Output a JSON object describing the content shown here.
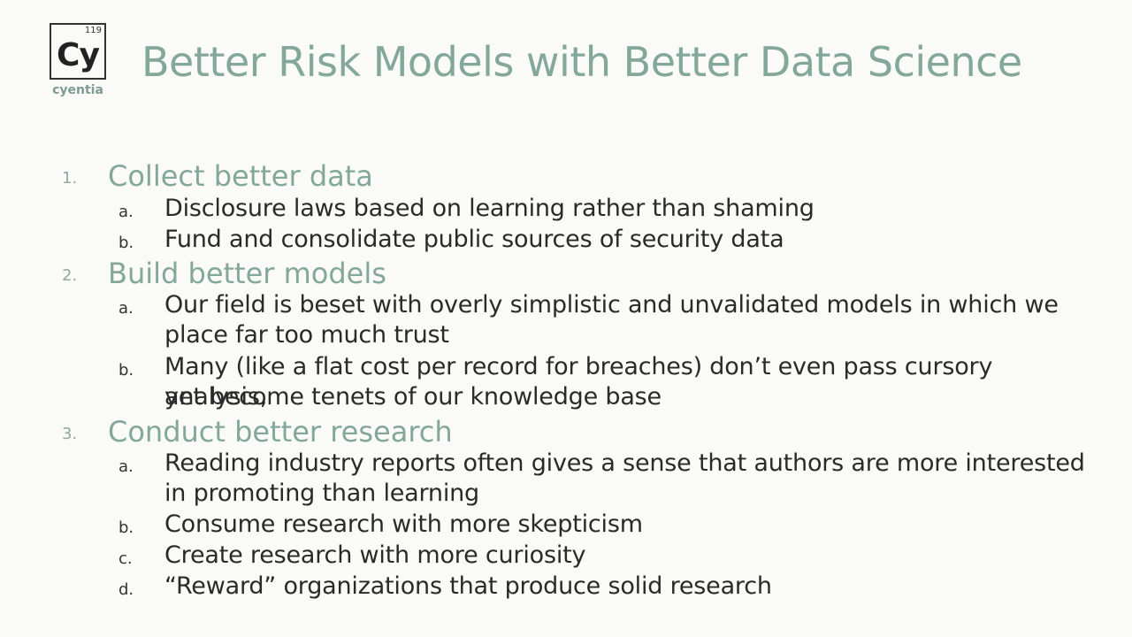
{
  "logo": {
    "number": "119",
    "symbol": "Cy",
    "word": "cyentia"
  },
  "title": "Better Risk Models with Better Data Science",
  "sections": [
    {
      "num": "1.",
      "label": "Collect better data",
      "items": [
        {
          "letter": "a.",
          "text": "Disclosure laws based on learning rather than shaming"
        },
        {
          "letter": "b.",
          "text": "Fund and consolidate public sources of security data"
        }
      ]
    },
    {
      "num": "2.",
      "label": "Build better models",
      "items": [
        {
          "letter": "a.",
          "line1": "Our field is beset with overly simplistic and unvalidated models in which we",
          "line2": "place far too much trust"
        },
        {
          "letter": "b.",
          "line1": "Many (like a flat cost per record for breaches) don’t even pass cursory analysis,",
          "line2": "yet become tenets of our knowledge base"
        }
      ]
    },
    {
      "num": "3.",
      "label": "Conduct better research",
      "items": [
        {
          "letter": "a.",
          "line1": "Reading industry reports often gives a sense that authors are more interested",
          "line2": "in promoting than learning"
        },
        {
          "letter": "b.",
          "text": "Consume research with more skepticism"
        },
        {
          "letter": "c.",
          "text": "Create research with more curiosity"
        },
        {
          "letter": "d.",
          "text": "“Reward” organizations that produce solid research"
        }
      ]
    }
  ]
}
